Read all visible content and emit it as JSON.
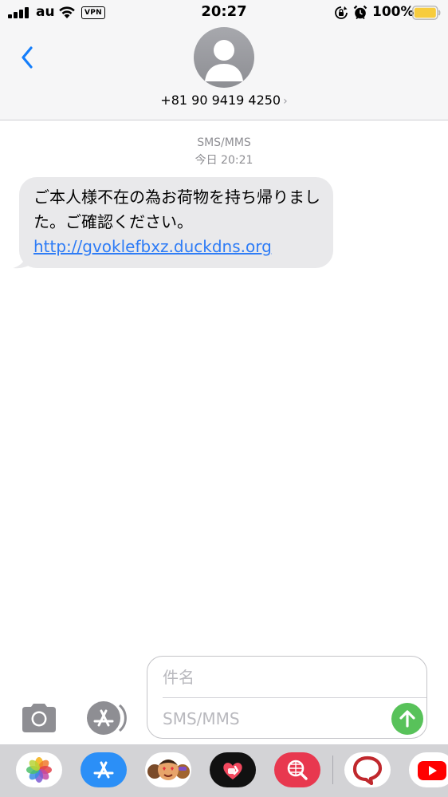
{
  "status_bar": {
    "carrier": "au",
    "vpn": "VPN",
    "time": "20:27",
    "battery_percent": "100%",
    "battery_level": 1.0,
    "icons": [
      "signal-icon",
      "wifi-icon",
      "rotation-lock-icon",
      "alarm-icon",
      "battery-icon"
    ]
  },
  "header": {
    "back_icon": "chevron-left-icon",
    "avatar_icon": "person-silhouette-icon",
    "contact_name": "+81 90 9419 4250",
    "contact_chevron": "›"
  },
  "conversation": {
    "service_label": "SMS/MMS",
    "timestamp": "今日 20:21",
    "messages": [
      {
        "direction": "incoming",
        "text": "ご本人様不在の為お荷物を持ち帰りました。ご確認ください。",
        "link": "http://gvoklefbxz.duckdns.org"
      }
    ]
  },
  "compose": {
    "subject_placeholder": "件名",
    "message_placeholder": "SMS/MMS",
    "camera_icon": "camera-icon",
    "appstore_icon": "app-store-icon",
    "send_icon": "arrow-up-icon"
  },
  "app_drawer": {
    "apps": [
      {
        "name": "photos",
        "icon": "photos-icon"
      },
      {
        "name": "app-store",
        "icon": "app-store-icon"
      },
      {
        "name": "memoji",
        "icon": "memoji-icon"
      },
      {
        "name": "digital-touch",
        "icon": "heart-touch-icon"
      },
      {
        "name": "images-search",
        "icon": "globe-search-icon"
      },
      {
        "name": "speech-bubble-app",
        "icon": "speech-bubble-icon"
      },
      {
        "name": "youtube",
        "icon": "youtube-icon"
      }
    ]
  },
  "colors": {
    "header_bg": "#f6f6f7",
    "bubble_bg": "#e9e9eb",
    "link": "#2e7cf6",
    "accent_blue": "#147efb",
    "send_green": "#58c25a",
    "drawer_bg": "#d3d3d6",
    "battery_yellow": "#f7cc3d"
  }
}
